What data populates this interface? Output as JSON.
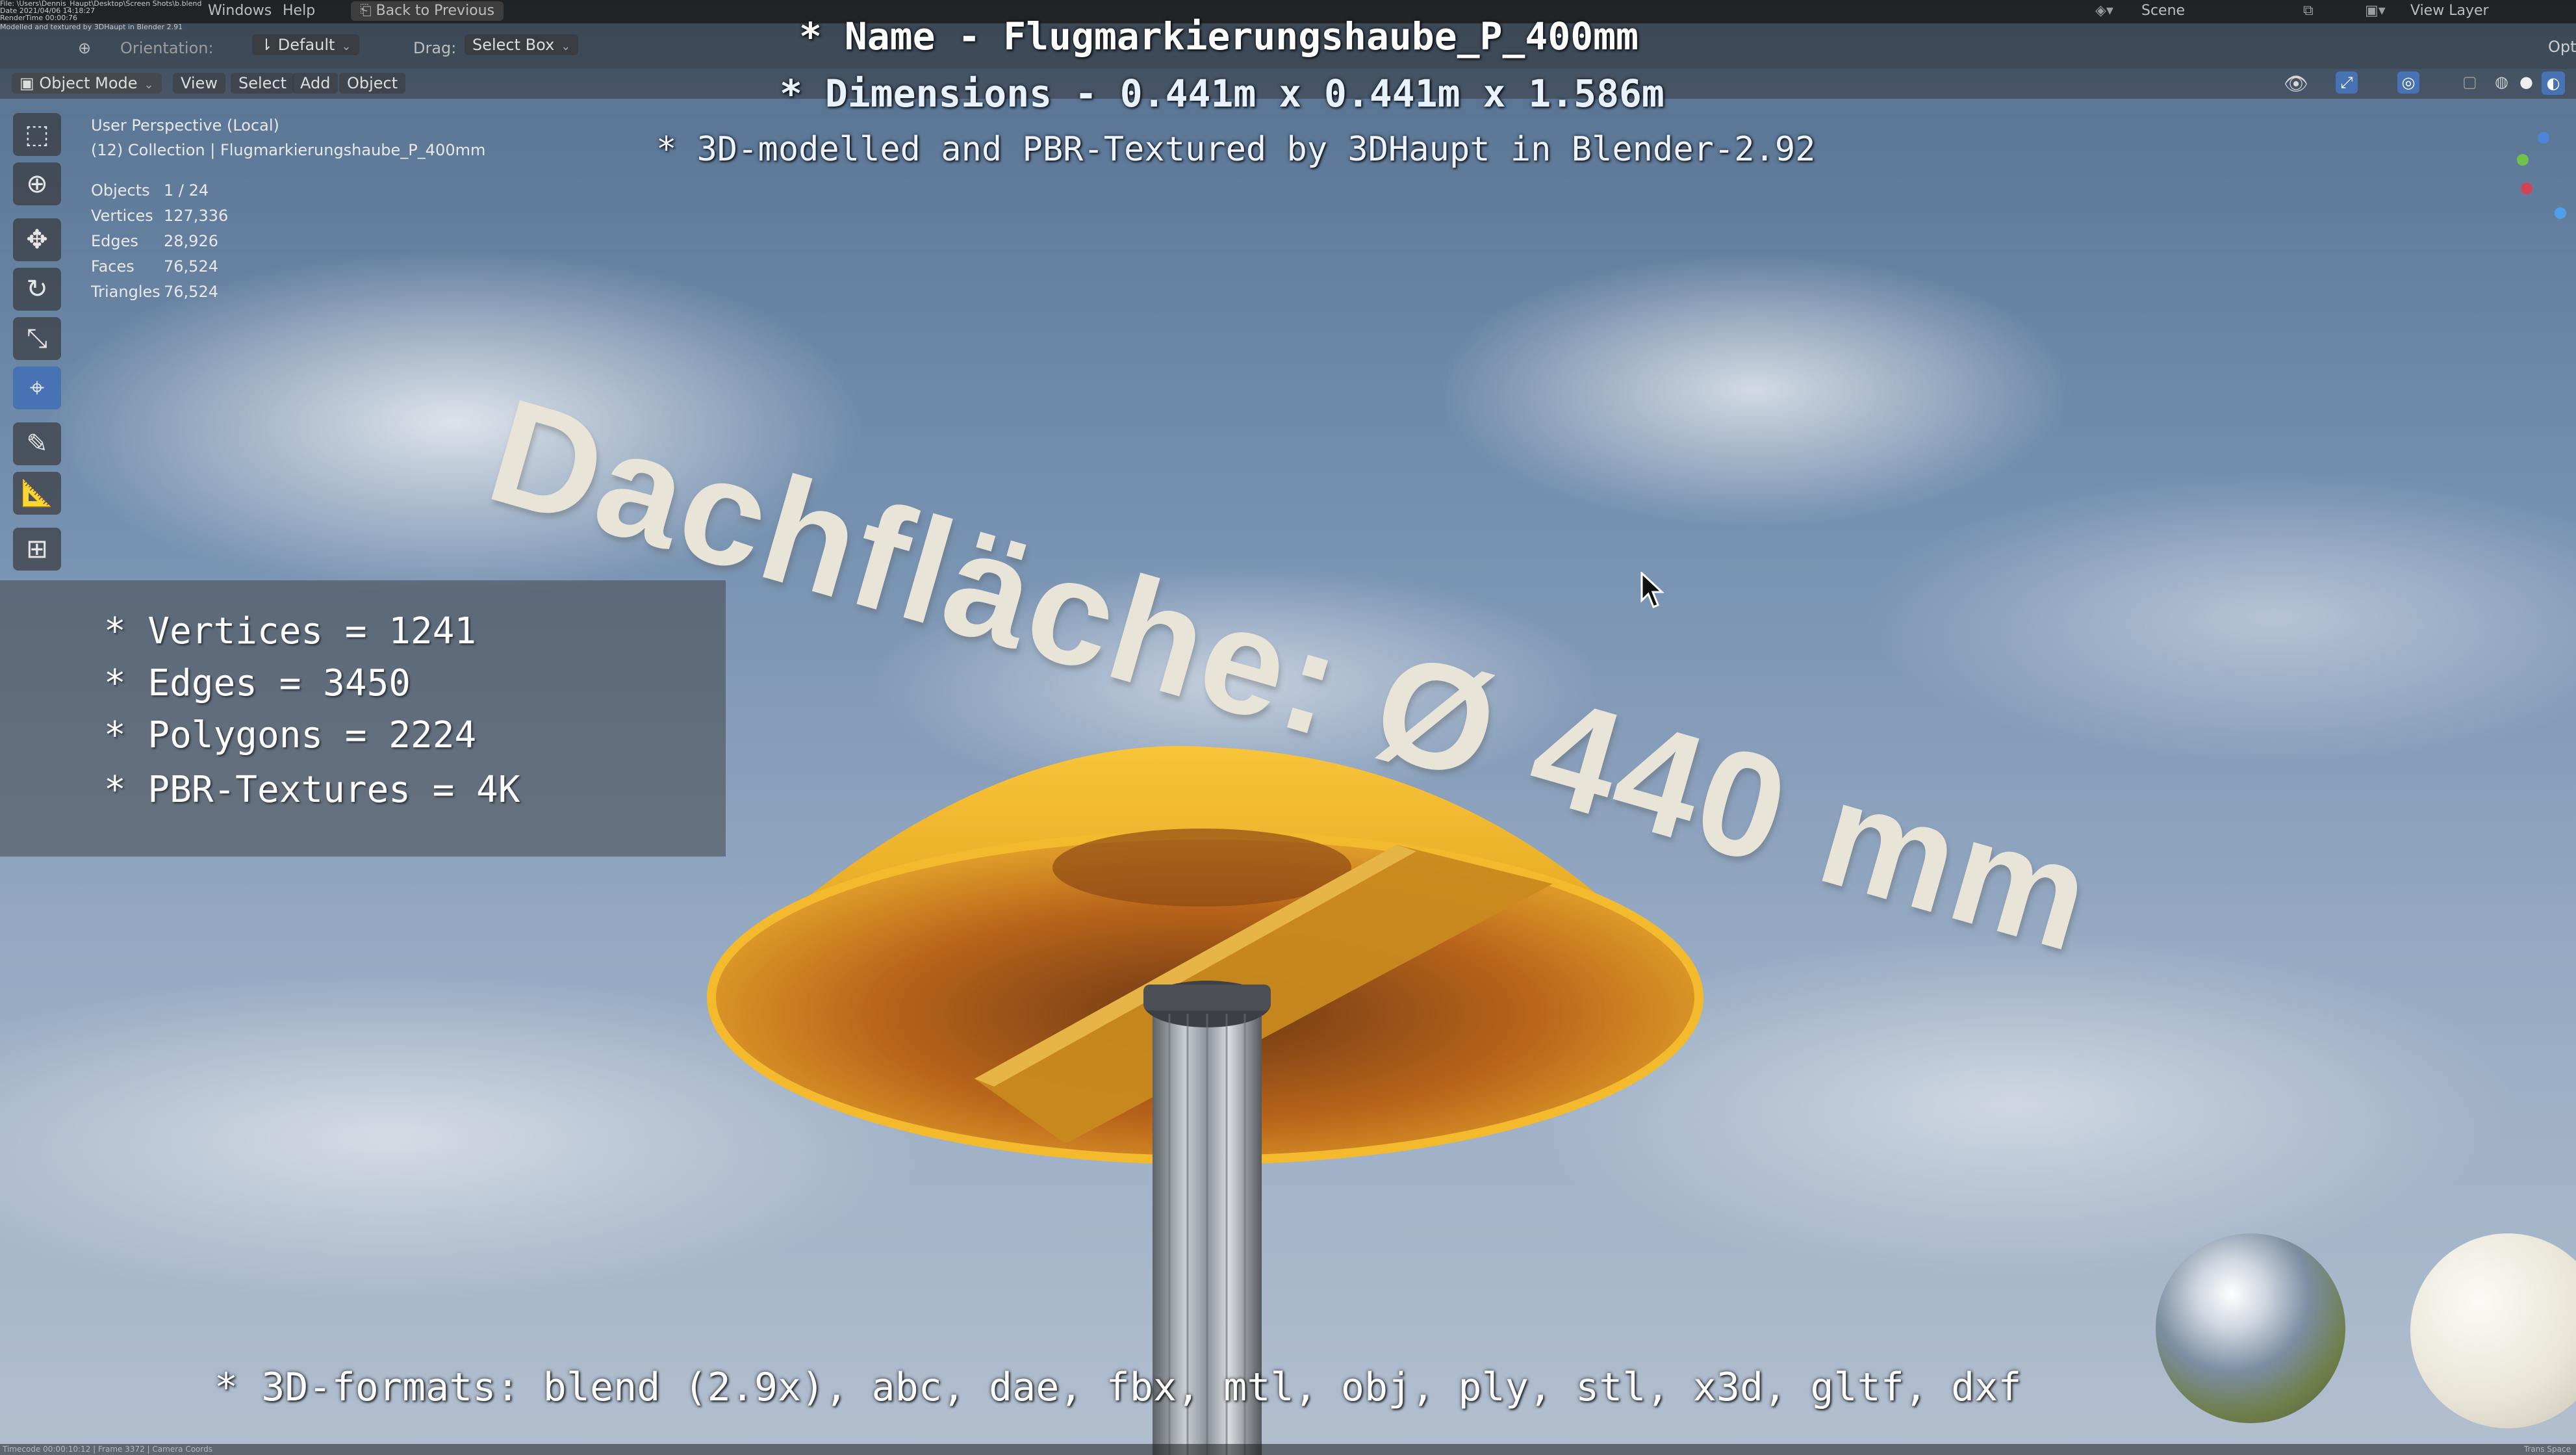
{
  "topbar": {
    "file_lines": [
      "File: \\Users\\Dennis_Haupt\\Desktop\\Screen Shots\\b.blend",
      "Date 2021/04/06 14:18:27",
      "RenderTime 00:00:76",
      "Modelled and textured by 3DHaupt in Blender 2.91"
    ],
    "menu_windows": "Windows",
    "menu_help": "Help",
    "back_label": "Back to Previous",
    "scene_label": "Scene",
    "view_layer_label": "View Layer"
  },
  "tool_header": {
    "orientation_label": "Orientation:",
    "orientation_value": "Default",
    "drag_label": "Drag:",
    "drag_value": "Select Box",
    "options_label": "Opti"
  },
  "mode_header": {
    "mode_label": "Object Mode",
    "menu": [
      "View",
      "Select",
      "Add",
      "Object"
    ]
  },
  "viewport": {
    "perspective": "User Perspective (Local)",
    "collection": "(12) Collection | Flugmarkierungshaube_P_400mm",
    "stats": [
      {
        "label": "Objects",
        "value": "1 / 24"
      },
      {
        "label": "Vertices",
        "value": "127,336"
      },
      {
        "label": "Edges",
        "value": "28,926"
      },
      {
        "label": "Faces",
        "value": "76,524"
      },
      {
        "label": "Triangles",
        "value": "76,524"
      }
    ]
  },
  "overlay": {
    "name_line": "* Name - Flugmarkierungshaube_P_400mm",
    "dimensions_line": "* Dimensions -  0.441m x 0.441m x 1.586m",
    "credit_line": "* 3D-modelled and PBR-Textured by 3DHaupt in Blender-2.92",
    "formats_line": "* 3D-formats: blend (2.9x), abc, dae, fbx, mtl, obj, ply, stl, x3d, gltf, dxf",
    "specs": [
      "* Vertices = 1241",
      "* Edges = 3450",
      "* Polygons = 2224",
      "* PBR-Textures = 4K"
    ],
    "dimension_text_3d": "Dachfläche:  Ø 440 mm"
  },
  "status": {
    "frame_info": "Timecode 00:00:10:12 | Frame 3372 | Camera Coords",
    "right_info": "Trans Space"
  },
  "colors": {
    "active_tool": "#4772b3",
    "cap_yellow": "#f0b21c",
    "cap_inner": "#b8641a",
    "pole_metal": "#8a8f95"
  },
  "icons": [
    "select-box-icon",
    "cursor-icon",
    "move-icon",
    "rotate-icon",
    "scale-icon",
    "transform-icon",
    "annotate-icon",
    "measure-icon",
    "add-cube-icon"
  ]
}
